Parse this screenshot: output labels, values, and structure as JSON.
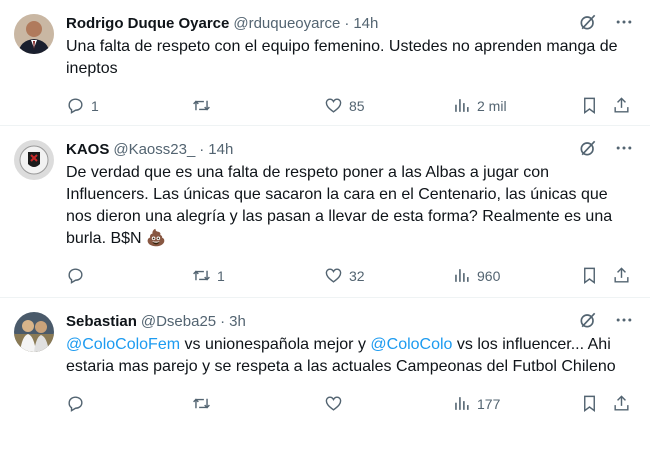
{
  "tweets": [
    {
      "name": "Rodrigo Duque Oyarce",
      "handle": "@rduqueoyarce",
      "dot": "·",
      "time": "14h",
      "text": "Una falta de respeto con el equipo femenino. Ustedes no aprenden manga de ineptos",
      "replies": "1",
      "retweets": "",
      "likes": "85",
      "views": "2 mil",
      "avatar_color": "#7a3b2e"
    },
    {
      "name": "KAOS",
      "handle": "@Kaoss23_",
      "dot": "·",
      "time": "14h",
      "text": "De verdad que es una falta de respeto poner a las Albas a jugar con Influencers. Las únicas que sacaron la cara en el Centenario, las únicas que nos dieron una alegría y las pasan a llevar de esta forma? Realmente es una burla. B$N 💩",
      "replies": "",
      "retweets": "1",
      "likes": "32",
      "views": "960",
      "avatar_color": "#d9d9d9"
    },
    {
      "name": "Sebastian",
      "handle": "@Dseba25",
      "dot": "·",
      "time": "3h",
      "mention_1": "@ColoColoFem",
      "text_1": " vs unionespañola mejor y ",
      "mention_2": "@ColoColo",
      "text_2": " vs los influencer... Ahi estaria mas parejo y se respeta a las actuales Campeonas del Futbol Chileno",
      "replies": "",
      "retweets": "",
      "likes": "",
      "views": "177",
      "avatar_color": "#8a7a55"
    }
  ],
  "colors": {
    "accent": "#1d9bf0",
    "muted": "#536471",
    "text": "#0f1419"
  }
}
